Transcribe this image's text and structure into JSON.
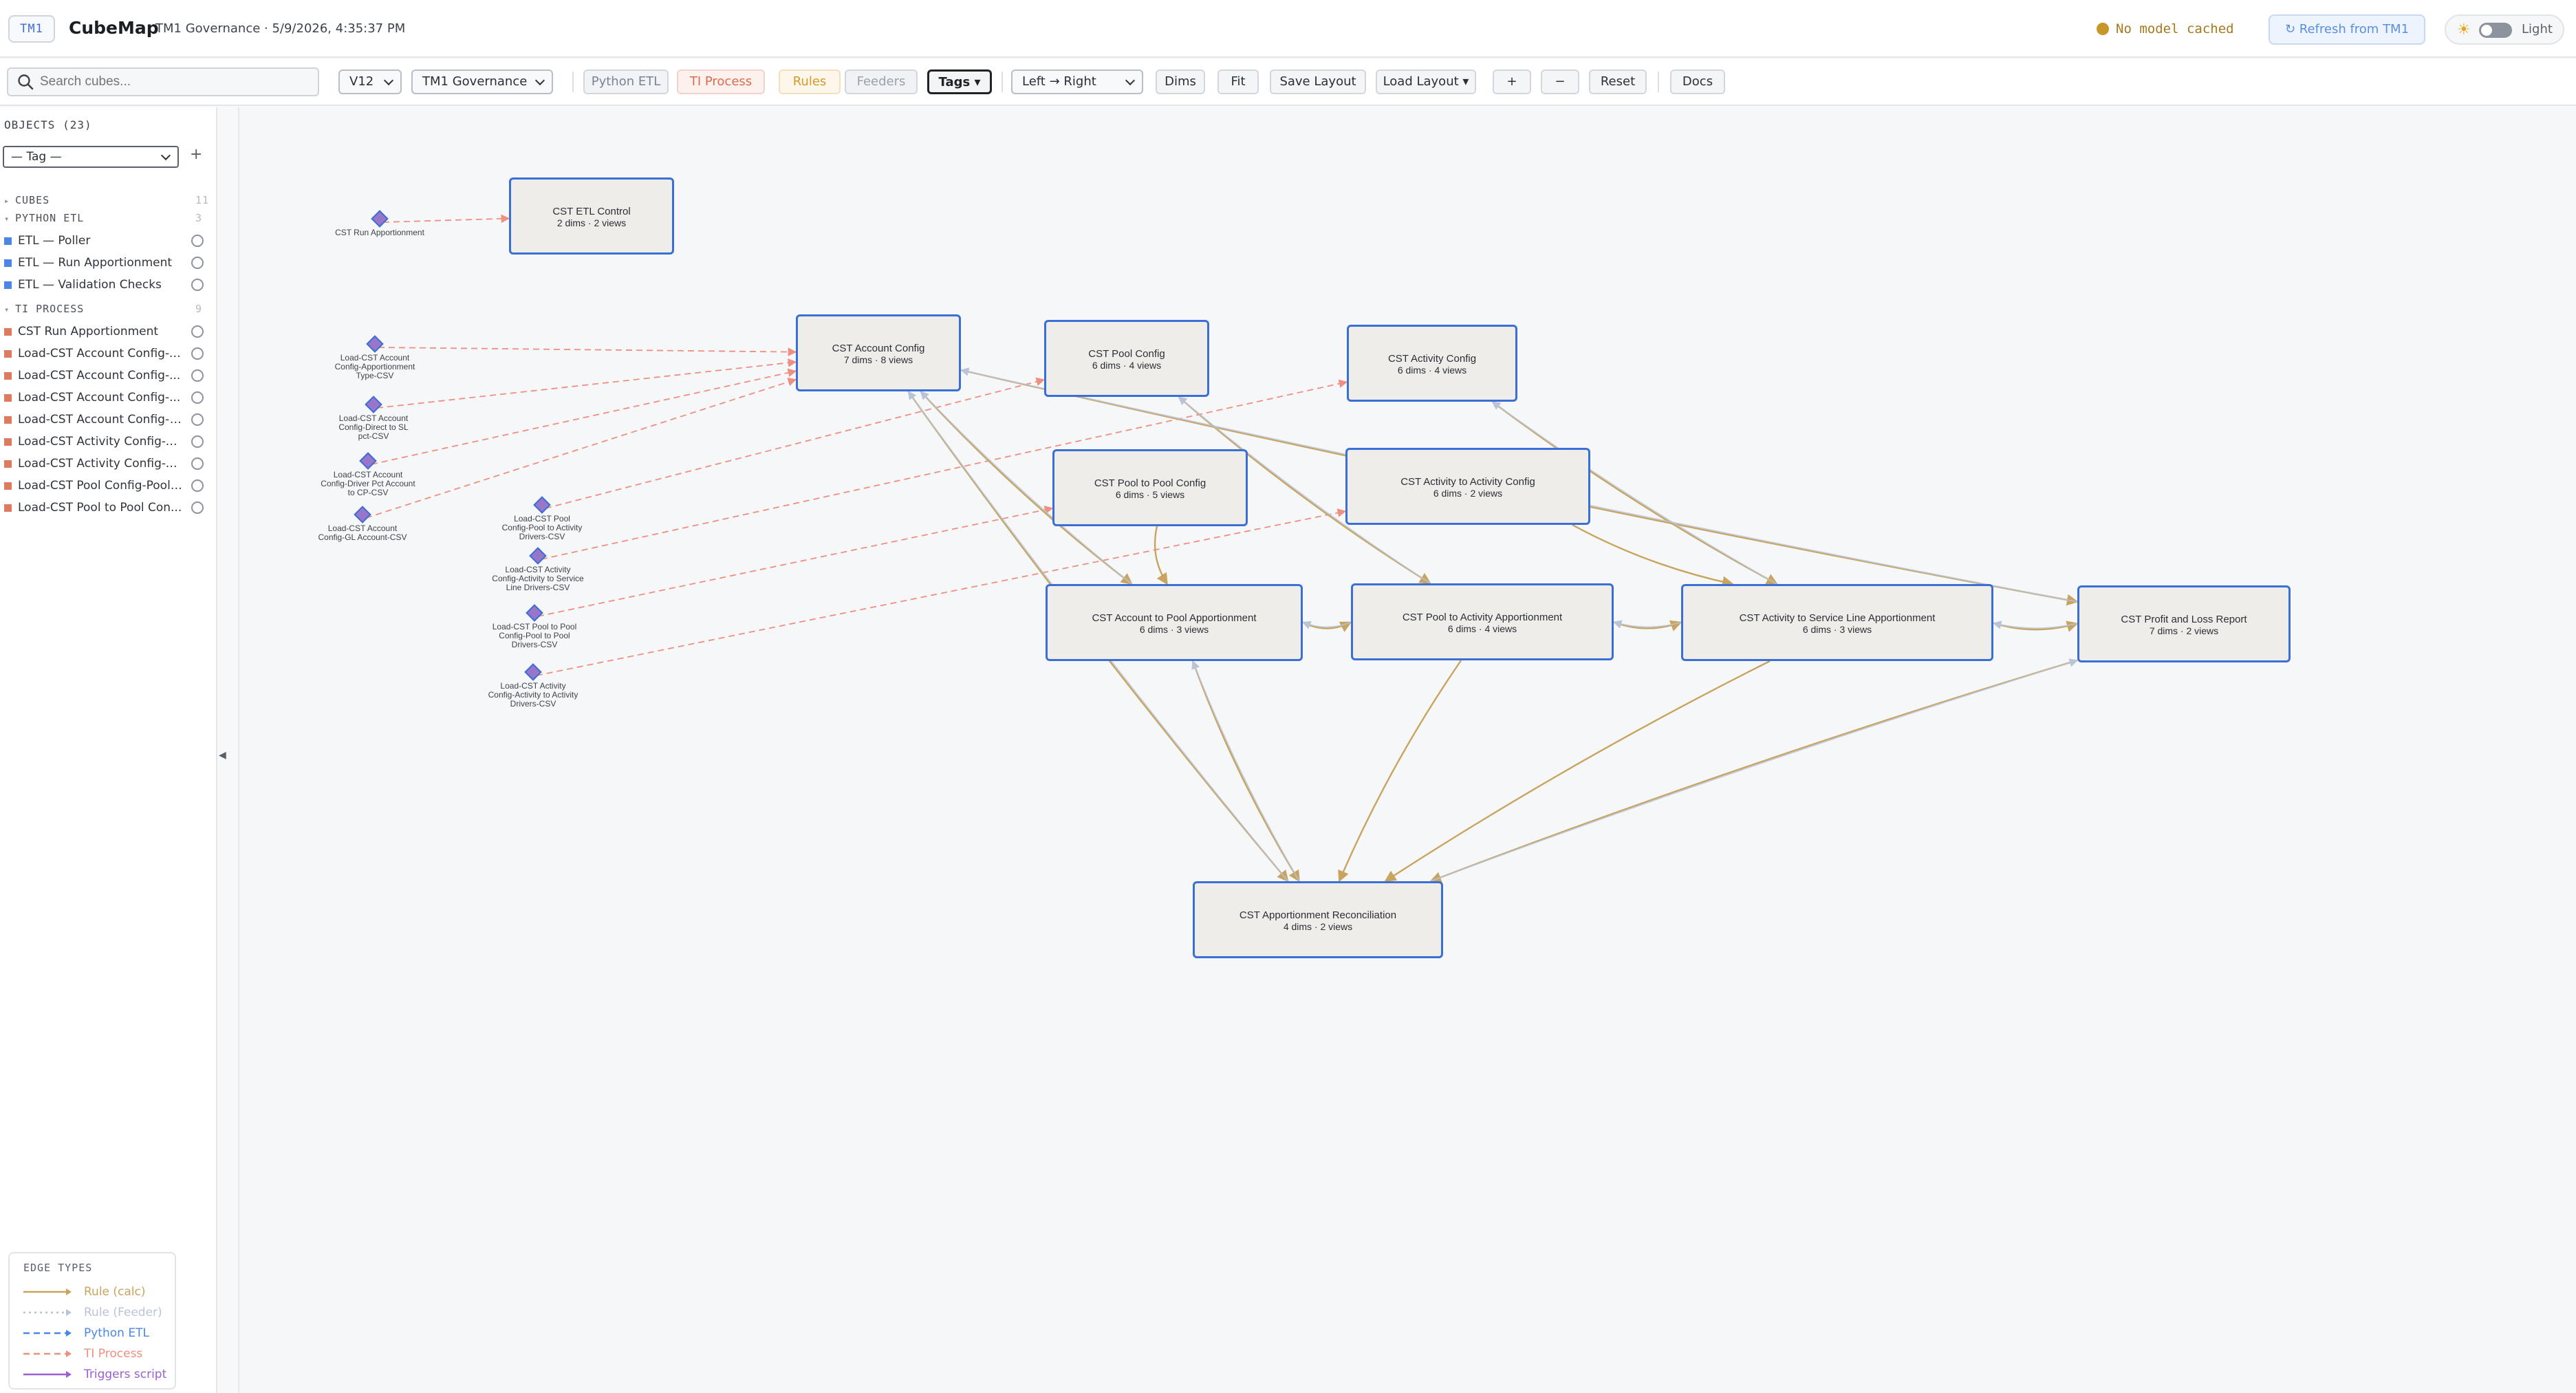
{
  "header": {
    "badge": "TM1",
    "title": "CubeMap",
    "subtitle": "TM1 Governance · 5/9/2026, 4:35:37 PM",
    "model_status": "No model cached",
    "refresh_label": "↻ Refresh from TM1",
    "theme_label": "Light"
  },
  "toolbar": {
    "search_placeholder": "Search cubes...",
    "version": "V12",
    "server": "TM1 Governance",
    "python_etl": "Python ETL",
    "ti_process": "TI Process",
    "rules": "Rules",
    "feeders": "Feeders",
    "tags": "Tags ▾",
    "direction": "Left → Right",
    "dims": "Dims",
    "fit": "Fit",
    "save_layout": "Save Layout",
    "load_layout": "Load Layout ▾",
    "zoom_in": "+",
    "zoom_out": "−",
    "reset": "Reset",
    "docs": "Docs"
  },
  "sidebar": {
    "objects_header": "OBJECTS (23)",
    "tag_filter": "— Tag —",
    "tag_add": "+",
    "sections": [
      {
        "title": "CUBES",
        "count": "11",
        "expanded": false,
        "items": []
      },
      {
        "title": "PYTHON ETL",
        "count": "3",
        "expanded": true,
        "color": "#4a86e8",
        "items": [
          "ETL — Poller",
          "ETL — Run Apportionment",
          "ETL — Validation Checks"
        ]
      },
      {
        "title": "TI PROCESS",
        "count": "9",
        "expanded": true,
        "color": "#e07a5f",
        "items": [
          "CST Run Apportionment",
          "Load-CST Account Config-A...",
          "Load-CST Account Config-...",
          "Load-CST Account Config-...",
          "Load-CST Account Config-G...",
          "Load-CST Activity Config-A...",
          "Load-CST Activity Config-A...",
          "Load-CST Pool Config-Pool ...",
          "Load-CST Pool to Pool Con..."
        ]
      }
    ]
  },
  "graph": {
    "cubes": [
      {
        "id": "etl",
        "name": "CST ETL Control",
        "meta": "2 dims  ·  2 views"
      },
      {
        "id": "acct",
        "name": "CST Account Config",
        "meta": "7 dims  ·  8 views"
      },
      {
        "id": "pool",
        "name": "CST Pool Config",
        "meta": "6 dims  ·  4 views"
      },
      {
        "id": "act",
        "name": "CST Activity Config",
        "meta": "6 dims  ·  4 views"
      },
      {
        "id": "p2p",
        "name": "CST Pool to Pool Config",
        "meta": "6 dims  ·  5 views"
      },
      {
        "id": "a2a",
        "name": "CST Activity to Activity Config",
        "meta": "6 dims  ·  2 views"
      },
      {
        "id": "a2pa",
        "name": "CST Account to Pool Apportionment",
        "meta": "6 dims  ·  3 views"
      },
      {
        "id": "p2aa",
        "name": "CST Pool to Activity Apportionment",
        "meta": "6 dims  ·  4 views"
      },
      {
        "id": "a2sl",
        "name": "CST Activity to Service Line Apportionment",
        "meta": "6 dims  ·  3 views"
      },
      {
        "id": "pnl",
        "name": "CST Profit and Loss Report",
        "meta": "7 dims  ·  2 views"
      },
      {
        "id": "recon",
        "name": "CST Apportionment Reconciliation",
        "meta": "4 dims  ·  2 views"
      }
    ],
    "processes": [
      {
        "id": "runap",
        "lines": [
          "CST Run Apportionment"
        ]
      },
      {
        "id": "l1",
        "lines": [
          "Load-CST Account",
          "Config-Apportionment",
          "Type-CSV"
        ]
      },
      {
        "id": "l2",
        "lines": [
          "Load-CST Account",
          "Config-Direct to SL",
          "pct-CSV"
        ]
      },
      {
        "id": "l3",
        "lines": [
          "Load-CST Account",
          "Config-Driver Pct Account",
          "to CP-CSV"
        ]
      },
      {
        "id": "l4",
        "lines": [
          "Load-CST Account",
          "Config-GL Account-CSV"
        ]
      },
      {
        "id": "l5",
        "lines": [
          "Load-CST Pool",
          "Config-Pool to Activity",
          "Drivers-CSV"
        ]
      },
      {
        "id": "l6",
        "lines": [
          "Load-CST Activity",
          "Config-Activity to Service",
          "Line Drivers-CSV"
        ]
      },
      {
        "id": "l7",
        "lines": [
          "Load-CST Pool to Pool",
          "Config-Pool to Pool",
          "Drivers-CSV"
        ]
      },
      {
        "id": "l8",
        "lines": [
          "Load-CST Activity",
          "Config-Activity to Activity",
          "Drivers-CSV"
        ]
      }
    ],
    "edge_colors": {
      "rule": "#c9a45f",
      "feeder": "#b9c4d8",
      "python": "#4a86e8",
      "ti": "#ee8f80",
      "trigger": "#9a5fd1"
    },
    "edges": [
      {
        "from": "runap",
        "to": "etl",
        "type": "ti"
      },
      {
        "from": "l1",
        "to": "acct",
        "type": "ti"
      },
      {
        "from": "l2",
        "to": "acct",
        "type": "ti"
      },
      {
        "from": "l3",
        "to": "acct",
        "type": "ti"
      },
      {
        "from": "l4",
        "to": "acct",
        "type": "ti"
      },
      {
        "from": "l5",
        "to": "pool",
        "type": "ti"
      },
      {
        "from": "l6",
        "to": "act",
        "type": "ti"
      },
      {
        "from": "l7",
        "to": "p2p",
        "type": "ti"
      },
      {
        "from": "l8",
        "to": "a2a",
        "type": "ti"
      },
      {
        "from": "acct",
        "to": "a2pa",
        "type": "rule"
      },
      {
        "from": "acct",
        "to": "recon",
        "type": "rule"
      },
      {
        "from": "acct",
        "to": "pnl",
        "type": "rule"
      },
      {
        "from": "pool",
        "to": "p2aa",
        "type": "rule"
      },
      {
        "from": "act",
        "to": "a2sl",
        "type": "rule"
      },
      {
        "from": "p2p",
        "to": "a2pa",
        "type": "rule"
      },
      {
        "from": "a2a",
        "to": "a2sl",
        "type": "rule"
      },
      {
        "from": "a2pa",
        "to": "p2aa",
        "type": "rule"
      },
      {
        "from": "p2aa",
        "to": "a2sl",
        "type": "rule"
      },
      {
        "from": "a2sl",
        "to": "pnl",
        "type": "rule"
      },
      {
        "from": "a2pa",
        "to": "recon",
        "type": "rule"
      },
      {
        "from": "p2aa",
        "to": "recon",
        "type": "rule"
      },
      {
        "from": "a2sl",
        "to": "recon",
        "type": "rule"
      },
      {
        "from": "pnl",
        "to": "recon",
        "type": "rule"
      },
      {
        "from": "a2pa",
        "to": "acct",
        "type": "feeder"
      },
      {
        "from": "p2aa",
        "to": "a2pa",
        "type": "feeder"
      },
      {
        "from": "a2sl",
        "to": "p2aa",
        "type": "feeder"
      },
      {
        "from": "pnl",
        "to": "a2sl",
        "type": "feeder"
      },
      {
        "from": "recon",
        "to": "acct",
        "type": "feeder"
      },
      {
        "from": "recon",
        "to": "a2pa",
        "type": "feeder"
      },
      {
        "from": "recon",
        "to": "pnl",
        "type": "feeder"
      },
      {
        "from": "a2sl",
        "to": "act",
        "type": "feeder"
      },
      {
        "from": "pnl",
        "to": "acct",
        "type": "feeder"
      },
      {
        "from": "p2aa",
        "to": "pool",
        "type": "feeder"
      }
    ]
  },
  "legend": {
    "title": "EDGE TYPES",
    "items": [
      {
        "label": "Rule (calc)",
        "type": "rule"
      },
      {
        "label": "Rule (Feeder)",
        "type": "feeder"
      },
      {
        "label": "Python ETL",
        "type": "python"
      },
      {
        "label": "TI Process",
        "type": "ti"
      },
      {
        "label": "Triggers script",
        "type": "trigger"
      }
    ]
  }
}
